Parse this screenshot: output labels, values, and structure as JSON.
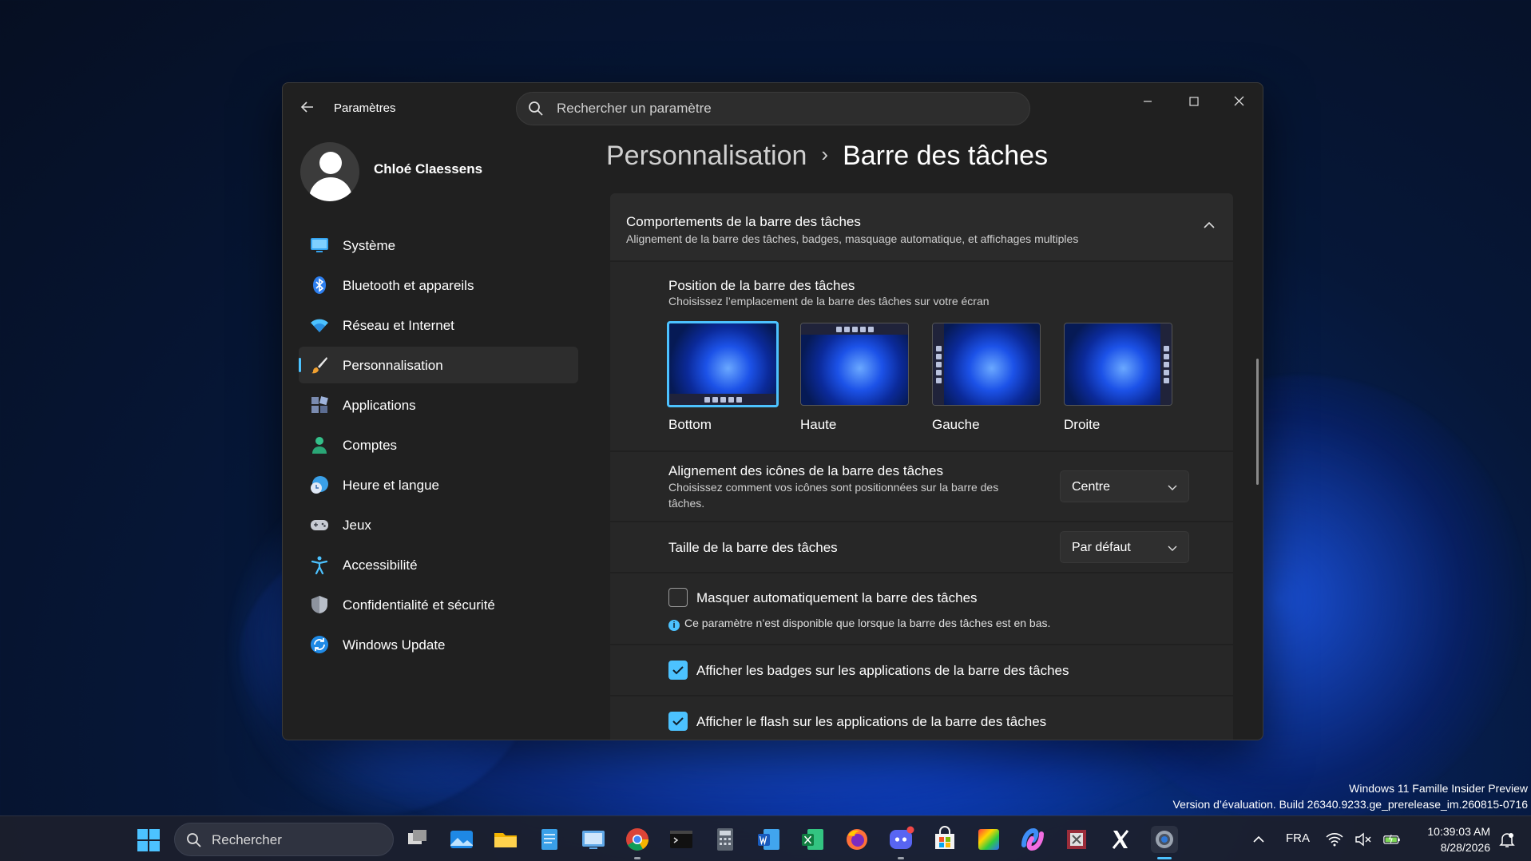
{
  "window": {
    "app_title": "Paramètres",
    "search_placeholder": "Rechercher un paramètre"
  },
  "profile": {
    "name": "Chloé Claessens"
  },
  "sidebar": {
    "items": [
      {
        "label": "Système",
        "icon": "monitor-icon",
        "active": false
      },
      {
        "label": "Bluetooth et appareils",
        "icon": "bluetooth-icon",
        "active": false
      },
      {
        "label": "Réseau et Internet",
        "icon": "wifi-icon",
        "active": false
      },
      {
        "label": "Personnalisation",
        "icon": "brush-icon",
        "active": true
      },
      {
        "label": "Applications",
        "icon": "apps-icon",
        "active": false
      },
      {
        "label": "Comptes",
        "icon": "person-icon",
        "active": false
      },
      {
        "label": "Heure et langue",
        "icon": "clock-globe-icon",
        "active": false
      },
      {
        "label": "Jeux",
        "icon": "gamepad-icon",
        "active": false
      },
      {
        "label": "Accessibilité",
        "icon": "accessibility-icon",
        "active": false
      },
      {
        "label": "Confidentialité et sécurité",
        "icon": "shield-icon",
        "active": false
      },
      {
        "label": "Windows Update",
        "icon": "update-icon",
        "active": false
      }
    ]
  },
  "breadcrumb": {
    "parent": "Personnalisation",
    "separator": "›",
    "current": "Barre des tâches"
  },
  "section": {
    "title": "Comportements de la barre des tâches",
    "subtitle": "Alignement de la barre des tâches, badges, masquage automatique, et affichages multiples"
  },
  "position": {
    "title": "Position de la barre des tâches",
    "subtitle": "Choisissez l’emplacement de la barre des tâches sur votre écran",
    "options": [
      {
        "label": "Bottom",
        "selected": true
      },
      {
        "label": "Haute",
        "selected": false
      },
      {
        "label": "Gauche",
        "selected": false
      },
      {
        "label": "Droite",
        "selected": false
      }
    ]
  },
  "alignment": {
    "title": "Alignement des icônes de la barre des tâches",
    "subtitle_line1": "Choisissez comment vos icônes sont positionnées sur la barre des",
    "subtitle_line2": "tâches.",
    "value": "Centre"
  },
  "size": {
    "title": "Taille de la barre des tâches",
    "value": "Par défaut"
  },
  "autohide": {
    "label": "Masquer automatiquement la barre des tâches",
    "checked": false,
    "info": "Ce paramètre n’est disponible que lorsque la barre des tâches est en bas."
  },
  "badges": {
    "label": "Afficher les badges sur les applications de la barre des tâches",
    "checked": true
  },
  "flash": {
    "label": "Afficher le flash sur les applications de la barre des tâches",
    "checked": true
  },
  "watermark": {
    "line1": "Windows 11 Famille Insider Preview",
    "line2": "Version d’évaluation. Build 26340.9233.ge_prerelease_im.260815-0716"
  },
  "taskbar": {
    "search_label": "Rechercher",
    "language": "FRA",
    "time": "10:39:03 AM",
    "date": "8/28/2026"
  },
  "colors": {
    "accent": "#4cc2ff",
    "window_bg": "#202020",
    "card_bg": "#2b2b2b"
  }
}
